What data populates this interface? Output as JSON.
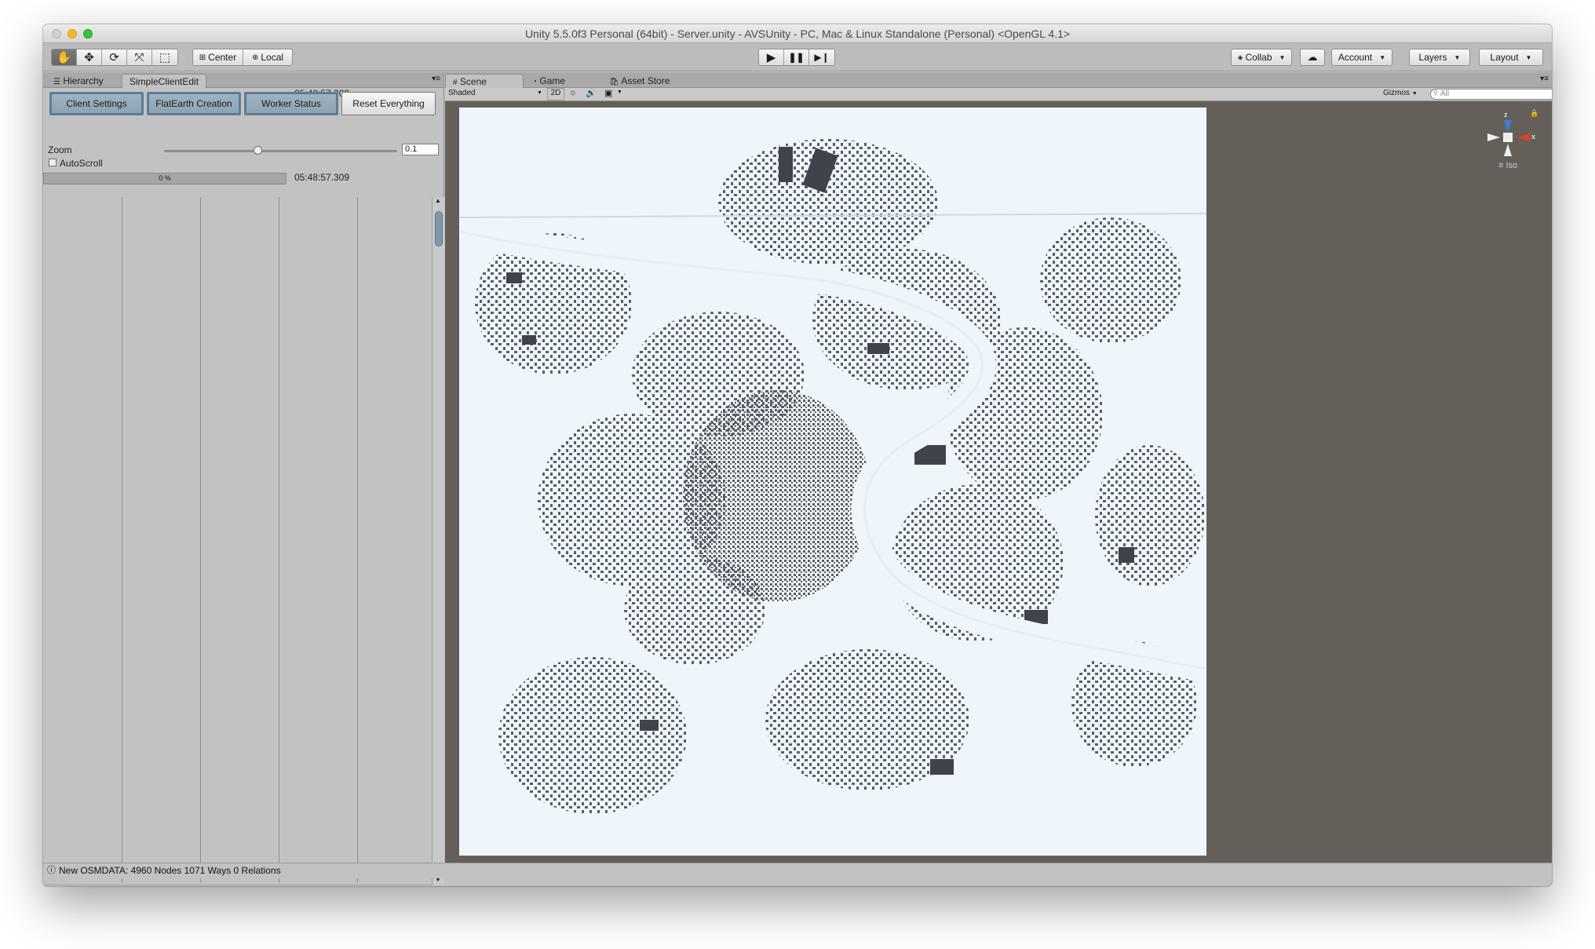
{
  "window": {
    "title": "Unity 5.5.0f3 Personal (64bit) - Server.unity - AVSUnity - PC, Mac & Linux Standalone (Personal) <OpenGL 4.1>"
  },
  "toolbar": {
    "transform_tools": [
      "hand-tool",
      "move-tool",
      "rotate-tool",
      "scale-tool",
      "rect-tool"
    ],
    "pivot_label": "Center",
    "space_label": "Local",
    "playback": [
      "play",
      "pause",
      "step"
    ],
    "collab_label": "Collab",
    "account_label": "Account",
    "layers_label": "Layers",
    "layout_label": "Layout"
  },
  "left_panel": {
    "tabs": [
      "Hierarchy",
      "SimpleClientEdit"
    ],
    "active_tab": "SimpleClientEdit",
    "buttons": [
      "Client Settings",
      "FlatEarth Creation",
      "Worker Status",
      "Reset Everything"
    ],
    "active_button": "Client Settings",
    "timestamp_top": "05:48:57.308",
    "zoom_label": "Zoom",
    "zoom_value": "0.1",
    "zoom_fraction": 0.32,
    "autoscroll_label": "AutoScroll",
    "progress_label": "0 %",
    "timestamp_bottom": "05:48:57.309"
  },
  "scene_panel": {
    "tabs": [
      "Scene",
      "Game",
      "Asset Store"
    ],
    "active_tab": "Scene",
    "shading_mode": "Shaded",
    "mode_2d": "2D",
    "gizmos_label": "Gizmos",
    "search_placeholder": "All",
    "gizmo_axis_z": "z",
    "gizmo_axis_x": "x",
    "projection_label": "Iso"
  },
  "status": {
    "message": "New OSMDATA: 4960 Nodes 1071 Ways 0 Relations"
  },
  "colors": {
    "active_button": "#8da2b1",
    "scene_bg": "#646059",
    "map_bg": "#eef6fb",
    "buildings": "#3e434c"
  }
}
